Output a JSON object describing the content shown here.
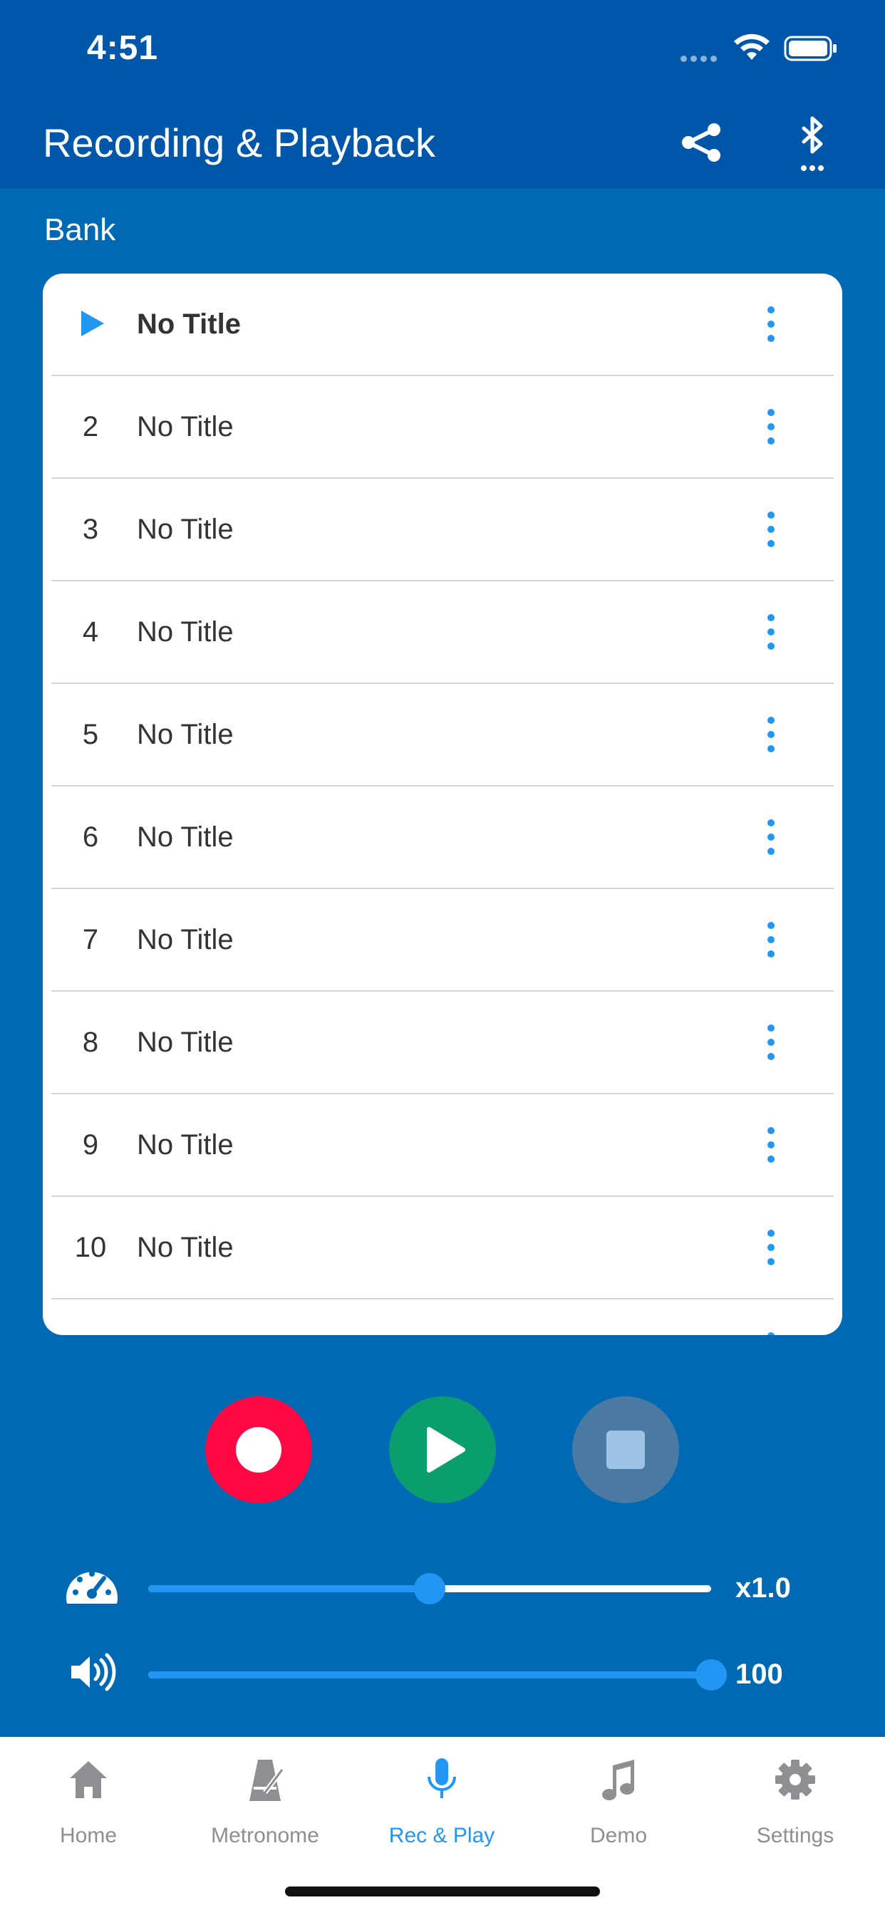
{
  "status": {
    "time": "4:51"
  },
  "navbar": {
    "title": "Recording & Playback",
    "share_icon": "share-icon",
    "bluetooth_icon": "bluetooth-icon"
  },
  "bank": {
    "label": "Bank"
  },
  "list": {
    "rows": [
      {
        "num": "",
        "title": "No Title",
        "active": true
      },
      {
        "num": "2",
        "title": "No Title"
      },
      {
        "num": "3",
        "title": "No Title"
      },
      {
        "num": "4",
        "title": "No Title"
      },
      {
        "num": "5",
        "title": "No Title"
      },
      {
        "num": "6",
        "title": "No Title"
      },
      {
        "num": "7",
        "title": "No Title"
      },
      {
        "num": "8",
        "title": "No Title"
      },
      {
        "num": "9",
        "title": "No Title"
      },
      {
        "num": "10",
        "title": "No Title"
      }
    ]
  },
  "transport": {
    "record_icon": "record-icon",
    "play_icon": "play-icon",
    "stop_icon": "stop-icon"
  },
  "tempo": {
    "value_label": "x1.0",
    "position": 0.5
  },
  "volume": {
    "value_label": "100",
    "position": 1.0
  },
  "tabs": [
    {
      "label": "Home",
      "icon": "home-icon"
    },
    {
      "label": "Metronome",
      "icon": "metronome-icon"
    },
    {
      "label": "Rec & Play",
      "icon": "microphone-icon",
      "selected": true
    },
    {
      "label": "Demo",
      "icon": "music-note-icon"
    },
    {
      "label": "Settings",
      "icon": "gear-icon"
    }
  ],
  "colors": {
    "background": "#0069b4",
    "navbar": "#0056a8",
    "accent": "#2196f3",
    "record": "#ff0844",
    "play": "#0a9e6e",
    "stop": "#4b7ba3"
  }
}
